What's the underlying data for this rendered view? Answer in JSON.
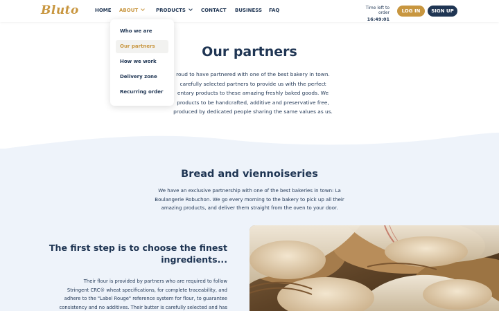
{
  "header": {
    "logo_text": "Bluto",
    "nav": [
      {
        "label": "HOME"
      },
      {
        "label": "ABOUT"
      },
      {
        "label": "PRODUCTS"
      },
      {
        "label": "CONTACT"
      },
      {
        "label": "BUSINESS"
      },
      {
        "label": "FAQ"
      }
    ],
    "timer_label": "Time left to order",
    "timer_value": "16:49:01",
    "login_label": "LOG IN",
    "signup_label": "SIGN UP"
  },
  "dropdown": {
    "items": [
      {
        "label": "Who we are"
      },
      {
        "label": "Our partners"
      },
      {
        "label": "How we work"
      },
      {
        "label": "Delivery zone"
      },
      {
        "label": "Recurring order"
      }
    ]
  },
  "partners": {
    "title": "Our partners",
    "lines": [
      "roud to have partnered with one of the best bakery in town.",
      "carefully selected partners to provide us with the perfect",
      "entary products to these amazing freshly baked goods. We",
      "products to be handcrafted, additive and preservative free,",
      "produced by dedicated people sharing the same values as us."
    ]
  },
  "bread": {
    "title": "Bread and viennoiseries",
    "lines": [
      "We have an exclusive partnership with one of the best bakeries in town: La",
      "Boulangerie Robuchon. We go every morning to the bakery to pick up all their",
      "amazing products, and deliver them straight from the oven to your door."
    ]
  },
  "first_step": {
    "title_lines": [
      "The first step is to choose the finest",
      "ingredients..."
    ],
    "lines": [
      "Their flour is provided by partners who are required to follow",
      "Stringent CRC® wheat specifications, for complete traceability, and",
      "adhere to the \"Label Rouge\" reference system for flour, to guarantee",
      "consistency and no additives. Their butter is carefully selected and has"
    ]
  },
  "colors": {
    "brand_gold": "#c8963f",
    "brand_navy": "#1f3553",
    "section_blue": "#eef3fa"
  }
}
